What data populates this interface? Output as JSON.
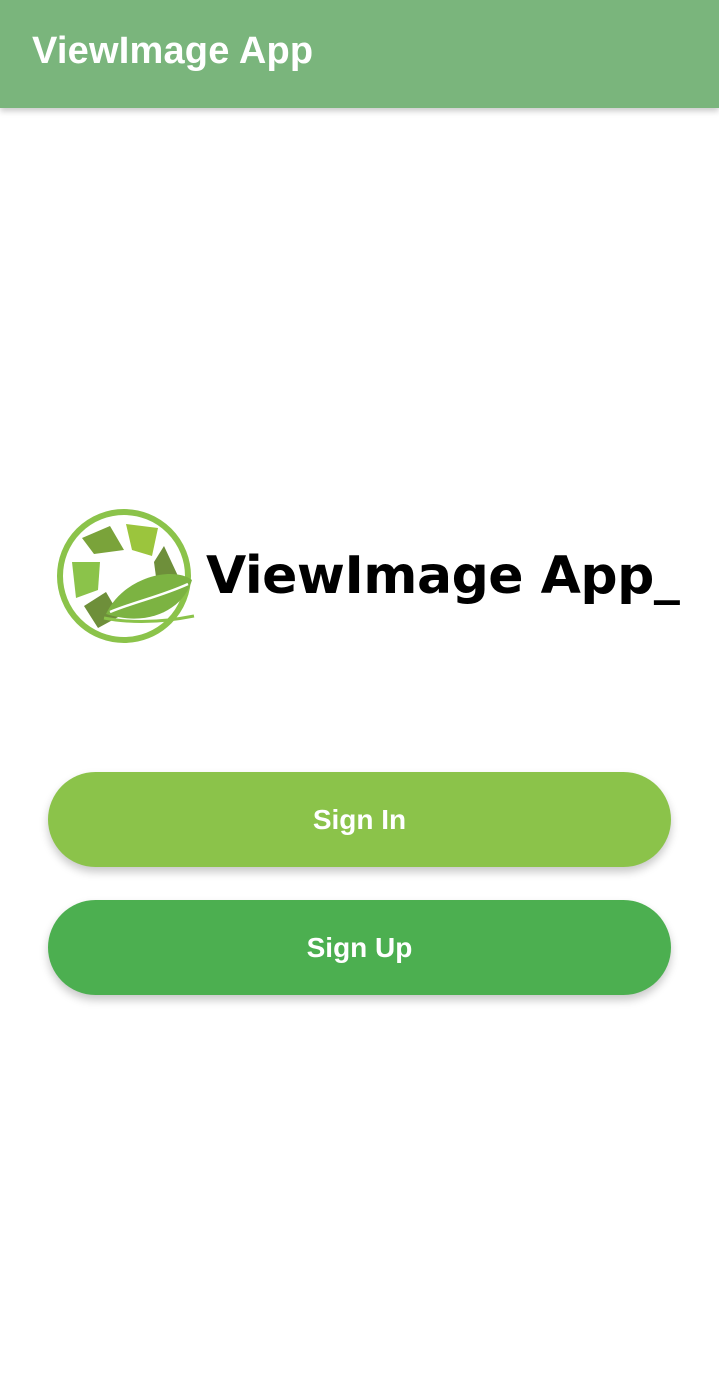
{
  "app_bar": {
    "title": "ViewImage App",
    "color": "#7ab57c"
  },
  "logo": {
    "text": "ViewImage App_",
    "icon": "aperture-leaf-icon",
    "colors": {
      "ring": "#8bc34a",
      "blades": [
        "#8bc34a",
        "#9bc53d",
        "#7aa33a",
        "#6e8f3a"
      ],
      "leaf": "#7cb342"
    }
  },
  "buttons": {
    "sign_in": {
      "label": "Sign In",
      "color": "#8bc34a"
    },
    "sign_up": {
      "label": "Sign Up",
      "color": "#4caf50"
    }
  }
}
